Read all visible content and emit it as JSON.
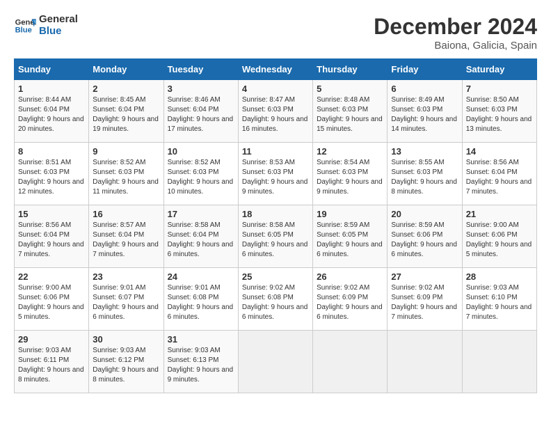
{
  "header": {
    "logo_line1": "General",
    "logo_line2": "Blue",
    "month": "December 2024",
    "location": "Baiona, Galicia, Spain"
  },
  "days_of_week": [
    "Sunday",
    "Monday",
    "Tuesday",
    "Wednesday",
    "Thursday",
    "Friday",
    "Saturday"
  ],
  "weeks": [
    [
      {
        "num": "1",
        "rise": "8:44 AM",
        "set": "6:04 PM",
        "daylight": "9 hours and 20 minutes."
      },
      {
        "num": "2",
        "rise": "8:45 AM",
        "set": "6:04 PM",
        "daylight": "9 hours and 19 minutes."
      },
      {
        "num": "3",
        "rise": "8:46 AM",
        "set": "6:04 PM",
        "daylight": "9 hours and 17 minutes."
      },
      {
        "num": "4",
        "rise": "8:47 AM",
        "set": "6:03 PM",
        "daylight": "9 hours and 16 minutes."
      },
      {
        "num": "5",
        "rise": "8:48 AM",
        "set": "6:03 PM",
        "daylight": "9 hours and 15 minutes."
      },
      {
        "num": "6",
        "rise": "8:49 AM",
        "set": "6:03 PM",
        "daylight": "9 hours and 14 minutes."
      },
      {
        "num": "7",
        "rise": "8:50 AM",
        "set": "6:03 PM",
        "daylight": "9 hours and 13 minutes."
      }
    ],
    [
      {
        "num": "8",
        "rise": "8:51 AM",
        "set": "6:03 PM",
        "daylight": "9 hours and 12 minutes."
      },
      {
        "num": "9",
        "rise": "8:52 AM",
        "set": "6:03 PM",
        "daylight": "9 hours and 11 minutes."
      },
      {
        "num": "10",
        "rise": "8:52 AM",
        "set": "6:03 PM",
        "daylight": "9 hours and 10 minutes."
      },
      {
        "num": "11",
        "rise": "8:53 AM",
        "set": "6:03 PM",
        "daylight": "9 hours and 9 minutes."
      },
      {
        "num": "12",
        "rise": "8:54 AM",
        "set": "6:03 PM",
        "daylight": "9 hours and 9 minutes."
      },
      {
        "num": "13",
        "rise": "8:55 AM",
        "set": "6:03 PM",
        "daylight": "9 hours and 8 minutes."
      },
      {
        "num": "14",
        "rise": "8:56 AM",
        "set": "6:04 PM",
        "daylight": "9 hours and 7 minutes."
      }
    ],
    [
      {
        "num": "15",
        "rise": "8:56 AM",
        "set": "6:04 PM",
        "daylight": "9 hours and 7 minutes."
      },
      {
        "num": "16",
        "rise": "8:57 AM",
        "set": "6:04 PM",
        "daylight": "9 hours and 7 minutes."
      },
      {
        "num": "17",
        "rise": "8:58 AM",
        "set": "6:04 PM",
        "daylight": "9 hours and 6 minutes."
      },
      {
        "num": "18",
        "rise": "8:58 AM",
        "set": "6:05 PM",
        "daylight": "9 hours and 6 minutes."
      },
      {
        "num": "19",
        "rise": "8:59 AM",
        "set": "6:05 PM",
        "daylight": "9 hours and 6 minutes."
      },
      {
        "num": "20",
        "rise": "8:59 AM",
        "set": "6:06 PM",
        "daylight": "9 hours and 6 minutes."
      },
      {
        "num": "21",
        "rise": "9:00 AM",
        "set": "6:06 PM",
        "daylight": "9 hours and 5 minutes."
      }
    ],
    [
      {
        "num": "22",
        "rise": "9:00 AM",
        "set": "6:06 PM",
        "daylight": "9 hours and 5 minutes."
      },
      {
        "num": "23",
        "rise": "9:01 AM",
        "set": "6:07 PM",
        "daylight": "9 hours and 6 minutes."
      },
      {
        "num": "24",
        "rise": "9:01 AM",
        "set": "6:08 PM",
        "daylight": "9 hours and 6 minutes."
      },
      {
        "num": "25",
        "rise": "9:02 AM",
        "set": "6:08 PM",
        "daylight": "9 hours and 6 minutes."
      },
      {
        "num": "26",
        "rise": "9:02 AM",
        "set": "6:09 PM",
        "daylight": "9 hours and 6 minutes."
      },
      {
        "num": "27",
        "rise": "9:02 AM",
        "set": "6:09 PM",
        "daylight": "9 hours and 7 minutes."
      },
      {
        "num": "28",
        "rise": "9:03 AM",
        "set": "6:10 PM",
        "daylight": "9 hours and 7 minutes."
      }
    ],
    [
      {
        "num": "29",
        "rise": "9:03 AM",
        "set": "6:11 PM",
        "daylight": "9 hours and 8 minutes."
      },
      {
        "num": "30",
        "rise": "9:03 AM",
        "set": "6:12 PM",
        "daylight": "9 hours and 8 minutes."
      },
      {
        "num": "31",
        "rise": "9:03 AM",
        "set": "6:13 PM",
        "daylight": "9 hours and 9 minutes."
      },
      null,
      null,
      null,
      null
    ]
  ]
}
